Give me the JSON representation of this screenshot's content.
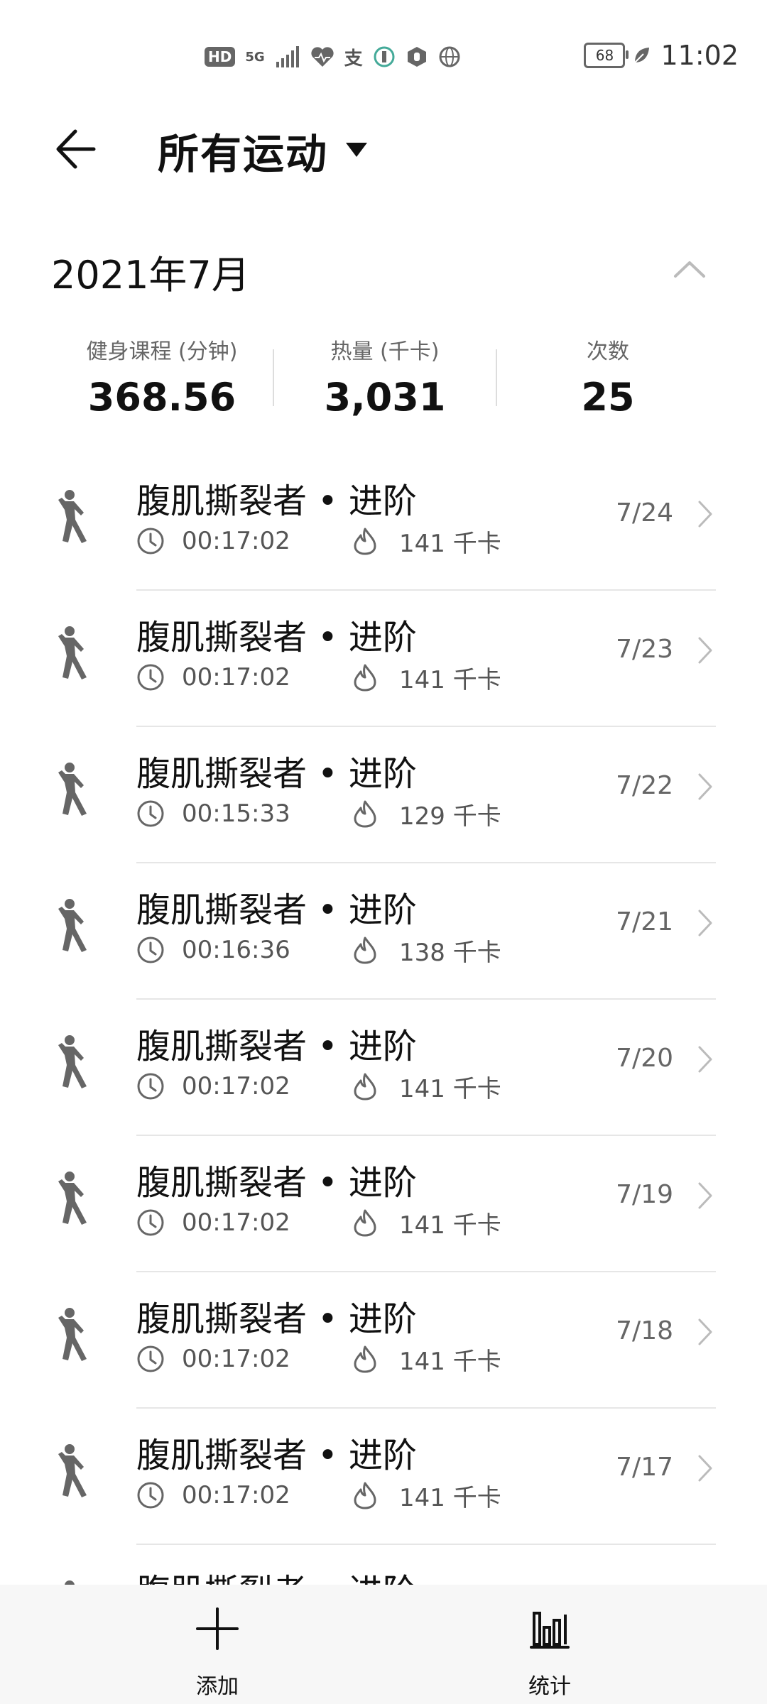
{
  "status_bar": {
    "left_icons": [
      "HD",
      "5G",
      "signal-icon",
      "heart-icon",
      "支",
      "app-icon",
      "hand-icon",
      "globe-icon"
    ],
    "battery": "68",
    "time": "11:02"
  },
  "header": {
    "title": "所有运动"
  },
  "month": {
    "label": "2021年7月",
    "stats": [
      {
        "label": "健身课程 (分钟)",
        "value": "368.56"
      },
      {
        "label": "热量 (千卡)",
        "value": "3,031"
      },
      {
        "label": "次数",
        "value": "25"
      }
    ]
  },
  "workouts": [
    {
      "title": "腹肌撕裂者 • 进阶",
      "duration": "00:17:02",
      "calories": "141 千卡",
      "date": "7/24"
    },
    {
      "title": "腹肌撕裂者 • 进阶",
      "duration": "00:17:02",
      "calories": "141 千卡",
      "date": "7/23"
    },
    {
      "title": "腹肌撕裂者 • 进阶",
      "duration": "00:15:33",
      "calories": "129 千卡",
      "date": "7/22"
    },
    {
      "title": "腹肌撕裂者 • 进阶",
      "duration": "00:16:36",
      "calories": "138 千卡",
      "date": "7/21"
    },
    {
      "title": "腹肌撕裂者 • 进阶",
      "duration": "00:17:02",
      "calories": "141 千卡",
      "date": "7/20"
    },
    {
      "title": "腹肌撕裂者 • 进阶",
      "duration": "00:17:02",
      "calories": "141 千卡",
      "date": "7/19"
    },
    {
      "title": "腹肌撕裂者 • 进阶",
      "duration": "00:17:02",
      "calories": "141 千卡",
      "date": "7/18"
    },
    {
      "title": "腹肌撕裂者 • 进阶",
      "duration": "00:17:02",
      "calories": "141 千卡",
      "date": "7/17"
    },
    {
      "title": "腹肌撕裂者 • 进阶",
      "duration": "",
      "calories": "",
      "date": ""
    }
  ],
  "bottom_bar": {
    "add_label": "添加",
    "stats_label": "统计"
  }
}
